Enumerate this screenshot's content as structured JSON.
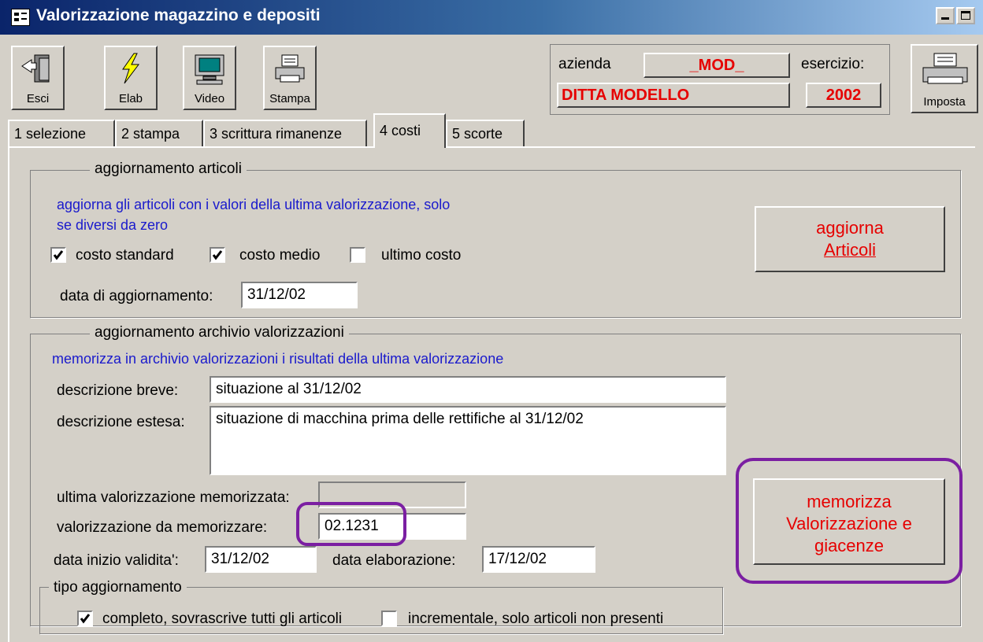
{
  "window": {
    "title": "Valorizzazione magazzino e depositi"
  },
  "toolbar": {
    "exit_label": "Esci",
    "elab_label": "Elab",
    "video_label": "Video",
    "print_label": "Stampa",
    "setup_label": "Imposta"
  },
  "info": {
    "company_label": "azienda",
    "company_code": "_MOD_",
    "company_name": "DITTA MODELLO",
    "year_label": "esercizio:",
    "year_value": "2002"
  },
  "tabs": [
    {
      "label": "1 selezione"
    },
    {
      "label": "2 stampa"
    },
    {
      "label": "3 scrittura rimanenze"
    },
    {
      "label": "4 costi"
    },
    {
      "label": "5 scorte"
    }
  ],
  "articles_update": {
    "group_title": "aggiornamento articoli",
    "description_line1": "aggiorna gli articoli con i valori della ultima valorizzazione, solo",
    "description_line2": "se diversi da zero",
    "checkbox_standard_label": "costo standard",
    "checkbox_medio_label": "costo medio",
    "checkbox_ultimo_label": "ultimo costo",
    "checkbox_standard_checked": true,
    "checkbox_medio_checked": true,
    "checkbox_ultimo_checked": false,
    "date_label": "data di aggiornamento:",
    "date_value": "31/12/02",
    "button_line1": "aggiorna",
    "button_line2": "Articoli"
  },
  "archive_update": {
    "group_title": "aggiornamento archivio valorizzazioni",
    "description": "memorizza in archivio valorizzazioni i risultati della ultima valorizzazione",
    "short_desc_label": "descrizione breve:",
    "short_desc_value": "situazione al 31/12/02",
    "long_desc_label": "descrizione estesa:",
    "long_desc_value": "situazione di macchina prima delle rettifiche al 31/12/02",
    "last_saved_label": "ultima valorizzazione memorizzata:",
    "last_saved_value": "",
    "to_save_label": "valorizzazione da memorizzare:",
    "to_save_value": "02.1231",
    "start_date_label": "data inizio validita':",
    "start_date_value": "31/12/02",
    "elab_date_label": "data elaborazione:",
    "elab_date_value": "17/12/02",
    "button_line1": "memorizza",
    "button_line2": "Valorizzazione e",
    "button_line3": "giacenze"
  },
  "update_type": {
    "group_title": "tipo aggiornamento",
    "complete_label": "completo, sovrascrive tutti gli articoli",
    "complete_checked": true,
    "incremental_label": "incrementale, solo articoli non presenti",
    "incremental_checked": false
  },
  "colors": {
    "title_gradient_start": "#0a246a",
    "label_red": "#e60000",
    "description_blue": "#1a1acc",
    "annotation_purple": "#7b1fa2",
    "face": "#d4d0c8"
  }
}
